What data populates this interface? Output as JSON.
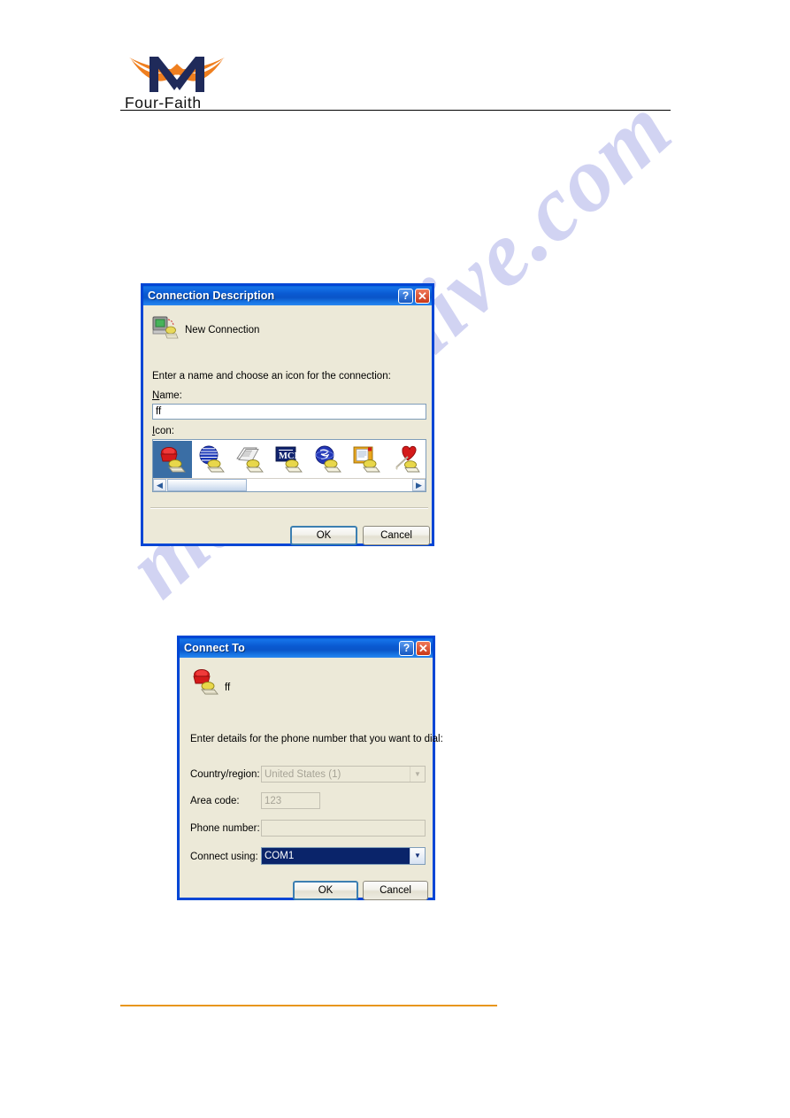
{
  "page": {
    "brand": "Four-Faith",
    "watermark": "manualshive.com",
    "accent_orange": "#e8961d",
    "brand_navy": "#1f2a5a"
  },
  "dialog1": {
    "title": "Connection Description",
    "help_glyph": "?",
    "close_glyph": "✕",
    "header_label": "New Connection",
    "prompt": "Enter a name and choose an icon for the connection:",
    "name_label_accel": "N",
    "name_label_rest": "ame:",
    "name_value": "ff",
    "icon_label_accel": "I",
    "icon_label_rest": "con:",
    "icons": [
      {
        "name": "telephone-icon",
        "selected": true
      },
      {
        "name": "globe-sphere-icon",
        "selected": false
      },
      {
        "name": "newspaper-icon",
        "selected": false
      },
      {
        "name": "mci-logo-icon",
        "selected": false
      },
      {
        "name": "world-network-icon",
        "selected": false
      },
      {
        "name": "document-notepad-icon",
        "selected": false
      },
      {
        "name": "heart-dart-icon",
        "selected": false
      }
    ],
    "scroll_left_glyph": "◀",
    "scroll_right_glyph": "▶",
    "ok_label": "OK",
    "cancel_label": "Cancel"
  },
  "dialog2": {
    "title": "Connect To",
    "help_glyph": "?",
    "close_glyph": "✕",
    "connection_name": "ff",
    "prompt": "Enter details for the phone number that you want to dial:",
    "fields": [
      {
        "label": "Country/region:",
        "control": "combo",
        "value": "United States (1)",
        "enabled": false
      },
      {
        "label": "Area code:",
        "control": "text",
        "value": "123",
        "enabled": false
      },
      {
        "label": "Phone number:",
        "control": "text",
        "value": "",
        "enabled": false
      },
      {
        "label": "Connect using:",
        "control": "combo",
        "value": "COM1",
        "enabled": true
      }
    ],
    "ok_label": "OK",
    "cancel_label": "Cancel"
  }
}
